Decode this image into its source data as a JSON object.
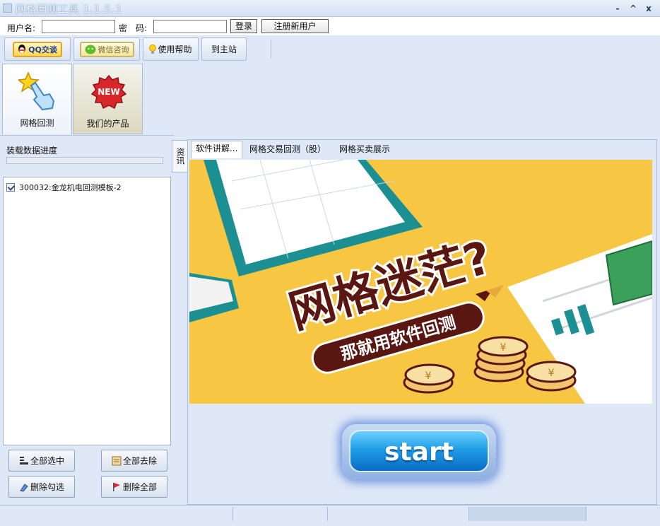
{
  "window": {
    "title": "网格回测工具 1.1.5.1",
    "minimize": "-",
    "restore": "^",
    "close": "x"
  },
  "login": {
    "username_label": "用户名:",
    "username_value": "",
    "password_label": "密　码:",
    "password_value": "",
    "login_button": "登录",
    "register_button": "注册新用户"
  },
  "toolbar": {
    "qq_button": "QQ交谈",
    "wechat_button": "微信咨询",
    "help_button": "使用帮助",
    "site_button": "到主站"
  },
  "nav": {
    "tabs": [
      {
        "label": "网格回测",
        "icon": "pointing-hand-star-icon",
        "active": true
      },
      {
        "label": "我们的产品",
        "icon": "new-badge-icon",
        "badge": "NEW",
        "active": false
      }
    ]
  },
  "left": {
    "progress_label": "装载数据进度",
    "progress_value": 0,
    "items": [
      {
        "label": "300032:金龙机电回测模板-2",
        "checked": true
      }
    ],
    "buttons": {
      "select_all": "全部选中",
      "remove_all": "全部去除",
      "delete_checked": "删除勾选",
      "delete_all": "删除全部"
    }
  },
  "side_tab": "资讯",
  "tabs": [
    {
      "label": "软件讲解...",
      "active": true
    },
    {
      "label": "网格交易回测（股）",
      "active": false
    },
    {
      "label": "网格买卖展示",
      "active": false
    }
  ],
  "banner": {
    "headline": "网格迷茫?",
    "subline": "那就用软件回测",
    "coin_symbol": "¥"
  },
  "start_button": "start",
  "colors": {
    "accent": "#1f9ee6",
    "banner_bg": "#f7c744",
    "banner_text": "#5a1712",
    "panel": "#dfe8f6"
  }
}
